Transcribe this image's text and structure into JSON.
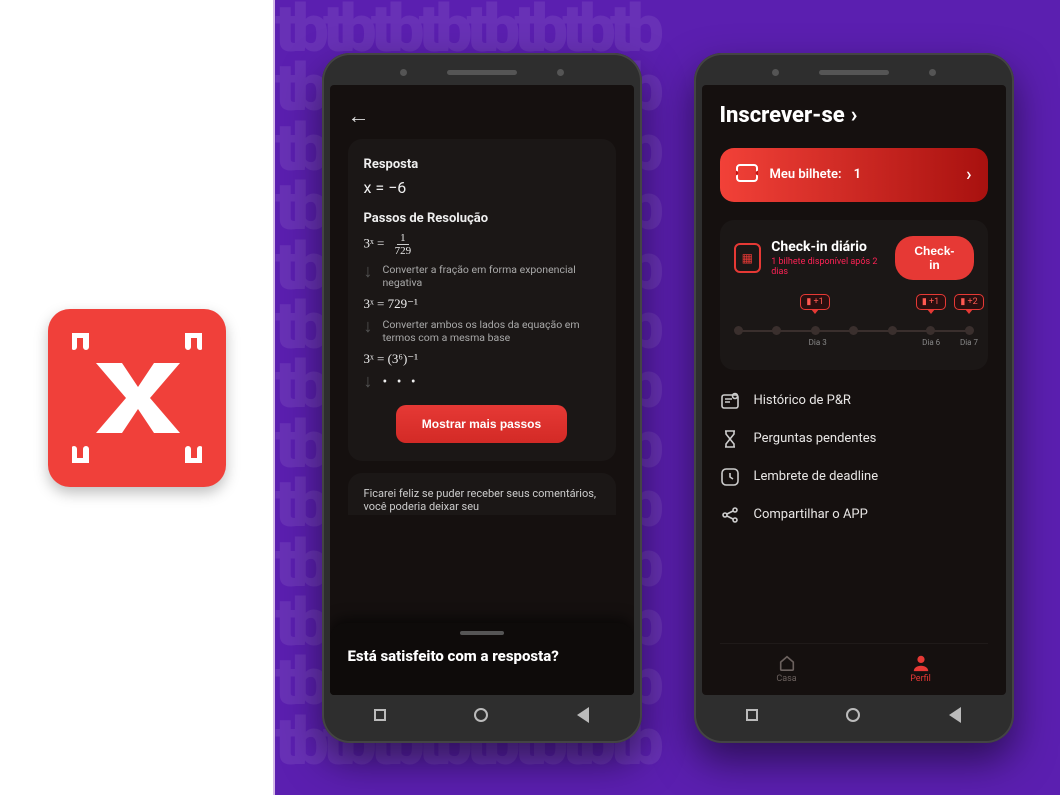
{
  "app_icon": {
    "letter": "X"
  },
  "phone1": {
    "answer_label": "Resposta",
    "answer_eq": "x = −6",
    "steps_label": "Passos de Resolução",
    "step1_math": "3ˣ =",
    "step1_frac_num": "1",
    "step1_frac_den": "729",
    "step1_note": "Converter a fração em forma exponencial negativa",
    "step2_math": "3ˣ = 729⁻¹",
    "step2_note": "Converter ambos os lados da equação em termos com a mesma base",
    "step3_math": "3ˣ = (3⁶)⁻¹",
    "ellipsis": "• • •",
    "show_more_btn": "Mostrar mais passos",
    "feedback_text": "Ficarei feliz se puder receber seus comentários, você poderia deixar seu",
    "sheet_title": "Está satisfeito com a resposta?"
  },
  "phone2": {
    "signup_title": "Inscrever-se",
    "ticket_label": "Meu bilhete:",
    "ticket_count": "1",
    "checkin_title": "Check-in diário",
    "checkin_sub": "1 bilhete disponível após 2 dias",
    "checkin_btn": "Check-in",
    "bonuses": {
      "d3": "▮ +1",
      "d6": "▮ +1",
      "d7": "▮ +2"
    },
    "day_labels": {
      "d3": "Dia 3",
      "d6": "Dia 6",
      "d7": "Dia 7"
    },
    "menu": {
      "history": "Histórico de P&R",
      "pending": "Perguntas pendentes",
      "deadline": "Lembrete de deadline",
      "share": "Compartilhar o APP"
    },
    "tabs": {
      "home": "Casa",
      "profile": "Perfil"
    }
  }
}
